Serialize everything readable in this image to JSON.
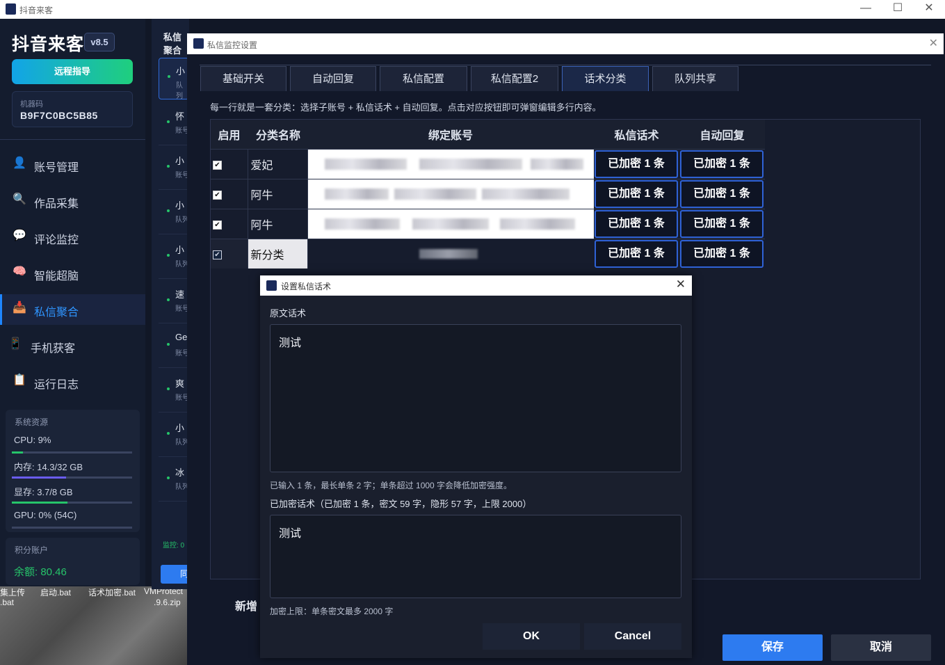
{
  "window": {
    "title": "抖音来客",
    "minimize": "—",
    "maximize": "☐",
    "close": "✕"
  },
  "sidebar": {
    "logo": "抖音来客",
    "version": "v8.5",
    "remote_button": "远程指导",
    "machine_code_label": "机器码",
    "machine_code": "B9F7C0BC5B85",
    "nav": [
      {
        "label": "账号管理",
        "icon": "user-icon"
      },
      {
        "label": "作品采集",
        "icon": "search-icon"
      },
      {
        "label": "评论监控",
        "icon": "comment-icon"
      },
      {
        "label": "智能超脑",
        "icon": "brain-icon"
      },
      {
        "label": "私信聚合",
        "icon": "inbox-icon"
      },
      {
        "label": "手机获客",
        "icon": "phone-icon"
      },
      {
        "label": "运行日志",
        "icon": "clipboard-icon"
      }
    ],
    "resources": {
      "header": "系统资源",
      "cpu": "CPU: 9%",
      "cpu_pct": 9,
      "mem": "内存: 14.3/32 GB",
      "mem_pct": 45,
      "vram": "显存: 3.7/8 GB",
      "vram_pct": 46,
      "gpu": "GPU: 0% (54C)",
      "gpu_pct": 0
    },
    "points": {
      "header": "积分账户",
      "balance": "余额: 80.46"
    }
  },
  "middle": {
    "header": "私信聚合",
    "items": [
      {
        "name": "小",
        "sub": "队列"
      },
      {
        "name": "怀",
        "sub": "账号"
      },
      {
        "name": "小",
        "sub": "账号"
      },
      {
        "name": "小",
        "sub": "队列"
      },
      {
        "name": "小",
        "sub": "队列"
      },
      {
        "name": "速",
        "sub": "账号"
      },
      {
        "name": "Ge",
        "sub": "账号"
      },
      {
        "name": "爽",
        "sub": "账号"
      },
      {
        "name": "小",
        "sub": "队列"
      },
      {
        "name": "冰",
        "sub": "队列"
      }
    ],
    "monitor": "监控: 0",
    "btn": "同"
  },
  "desktop": {
    "files": [
      "集上传",
      "启动.bat",
      "话术加密.bat",
      "VMProtect",
      ".bat",
      ".9.6.zip"
    ]
  },
  "settings_dialog": {
    "title": "私信监控设置",
    "tabs": [
      "基础开关",
      "自动回复",
      "私信配置",
      "私信配置2",
      "话术分类",
      "队列共享"
    ],
    "active_tab": 4,
    "hint": "每一行就是一套分类：选择子账号 + 私信话术 + 自动回复。点击对应按钮即可弹窗编辑多行内容。",
    "columns": [
      "启用",
      "分类名称",
      "绑定账号",
      "私信话术",
      "自动回复"
    ],
    "rows": [
      {
        "enabled": true,
        "name": "爱妃",
        "dm": "已加密 1 条",
        "reply": "已加密 1 条"
      },
      {
        "enabled": true,
        "name": "阿牛",
        "dm": "已加密 1 条",
        "reply": "已加密 1 条"
      },
      {
        "enabled": true,
        "name": "阿牛",
        "dm": "已加密 1 条",
        "reply": "已加密 1 条"
      },
      {
        "enabled": true,
        "name": "新分类",
        "dm": "已加密 1 条",
        "reply": "已加密 1 条"
      }
    ],
    "add_label": "新增",
    "save": "保存",
    "cancel": "取消"
  },
  "script_dialog": {
    "title": "设置私信话术",
    "original_label": "原文话术",
    "original_text": "测试",
    "input_info": "已输入 1 条，最长单条 2 字；单条超过 1000 字会降低加密强度。",
    "encrypted_label": "已加密话术（已加密 1 条，密文 59 字，隐形 57 字，上限 2000）",
    "encrypted_text": "测试",
    "limit_info": "加密上限：单条密文最多 2000 字",
    "ok": "OK",
    "cancel": "Cancel"
  },
  "colors": {
    "accent": "#2f95ff",
    "primary_button": "#2d7bf0",
    "success": "#26c46a"
  }
}
